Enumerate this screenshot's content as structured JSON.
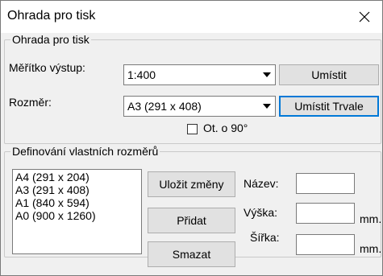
{
  "window": {
    "title": "Ohrada pro tisk"
  },
  "group_print": {
    "legend": "Ohrada pro tisk",
    "scale_label": "Měřítko výstup:",
    "scale_value": "1:400",
    "size_label": "Rozměr:",
    "size_value": "A3 (291 x 408)",
    "place_button": "Umístit",
    "place_permanent_button": "Umístit Trvale",
    "rotate_checkbox_label": "Ot. o 90°",
    "rotate_checked": false
  },
  "group_custom": {
    "legend": "Definování vlastních rozměrů",
    "list_items": [
      "A4 (291 x 204)",
      "A3 (291 x 408)",
      "A1 (840 x 594)",
      "A0 (900 x 1260)"
    ],
    "save_button": "Uložit změny",
    "add_button": "Přidat",
    "delete_button": "Smazat",
    "name_label": "Název:",
    "name_value": "",
    "height_label": "Výška:",
    "height_value": "",
    "height_unit": "mm.",
    "width_label": "Šířka:",
    "width_value": "",
    "width_unit": "mm."
  }
}
